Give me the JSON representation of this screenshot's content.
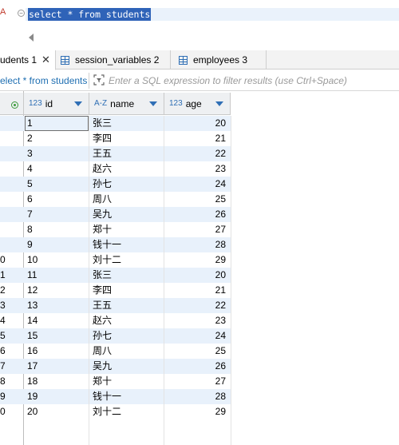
{
  "editor": {
    "gutter_mark": "A",
    "sql": "select * from students"
  },
  "tabs": [
    {
      "label": "udents 1",
      "active": true
    },
    {
      "label": "session_variables 2",
      "active": false
    },
    {
      "label": "employees 3",
      "active": false
    }
  ],
  "filter": {
    "query_label": "elect * from students",
    "placeholder": "Enter a SQL expression to filter results (use Ctrl+Space)"
  },
  "columns": [
    {
      "type": "123",
      "name": "id"
    },
    {
      "type": "A-Z",
      "name": "name"
    },
    {
      "type": "123",
      "name": "age"
    }
  ],
  "rows": [
    {
      "rn": "",
      "id": "1",
      "name": "张三",
      "age": "20"
    },
    {
      "rn": "",
      "id": "2",
      "name": "李四",
      "age": "21"
    },
    {
      "rn": "",
      "id": "3",
      "name": "王五",
      "age": "22"
    },
    {
      "rn": "",
      "id": "4",
      "name": "赵六",
      "age": "23"
    },
    {
      "rn": "",
      "id": "5",
      "name": "孙七",
      "age": "24"
    },
    {
      "rn": "",
      "id": "6",
      "name": "周八",
      "age": "25"
    },
    {
      "rn": "",
      "id": "7",
      "name": "吴九",
      "age": "26"
    },
    {
      "rn": "",
      "id": "8",
      "name": "郑十",
      "age": "27"
    },
    {
      "rn": "",
      "id": "9",
      "name": "钱十一",
      "age": "28"
    },
    {
      "rn": "0",
      "id": "10",
      "name": "刘十二",
      "age": "29"
    },
    {
      "rn": "1",
      "id": "11",
      "name": "张三",
      "age": "20"
    },
    {
      "rn": "2",
      "id": "12",
      "name": "李四",
      "age": "21"
    },
    {
      "rn": "3",
      "id": "13",
      "name": "王五",
      "age": "22"
    },
    {
      "rn": "4",
      "id": "14",
      "name": "赵六",
      "age": "23"
    },
    {
      "rn": "5",
      "id": "15",
      "name": "孙七",
      "age": "24"
    },
    {
      "rn": "6",
      "id": "16",
      "name": "周八",
      "age": "25"
    },
    {
      "rn": "7",
      "id": "17",
      "name": "吴九",
      "age": "26"
    },
    {
      "rn": "8",
      "id": "18",
      "name": "郑十",
      "age": "27"
    },
    {
      "rn": "9",
      "id": "19",
      "name": "钱十一",
      "age": "28"
    },
    {
      "rn": "0",
      "id": "20",
      "name": "刘十二",
      "age": "29"
    }
  ]
}
